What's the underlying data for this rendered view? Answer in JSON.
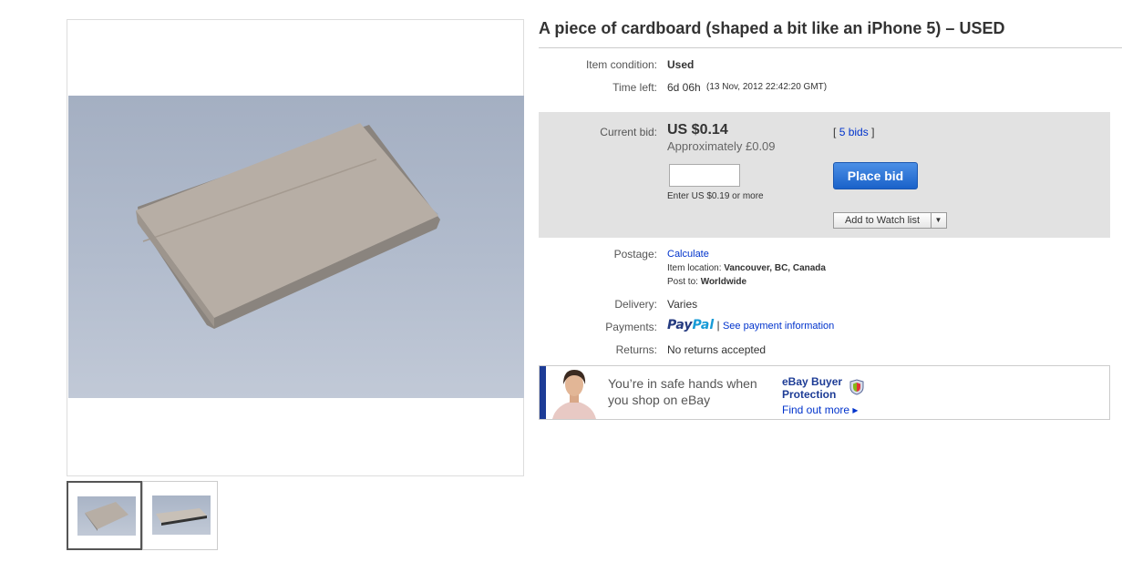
{
  "listing": {
    "title": "A piece of cardboard (shaped a bit like an iPhone 5) – USED",
    "condition_label": "Item condition:",
    "condition_value": "Used",
    "time_left_label": "Time left:",
    "time_left_value": "6d 06h",
    "time_left_end": "(13 Nov, 2012  22:42:20 GMT)"
  },
  "bid": {
    "current_label": "Current bid:",
    "price": "US $0.14",
    "approx": "Approximately £0.09",
    "bids_open": "[",
    "bids_link": "5 bids",
    "bids_close": "]",
    "input_value": "",
    "hint": "Enter US $0.19 or more",
    "place_bid_label": "Place bid",
    "watch_label": "Add to Watch list",
    "watch_arrow": "▼"
  },
  "shipping": {
    "postage_label": "Postage:",
    "postage_link": "Calculate",
    "location_label": "Item location:",
    "location_value": "Vancouver, BC, Canada",
    "post_to_label": "Post to:",
    "post_to_value": "Worldwide",
    "delivery_label": "Delivery:",
    "delivery_value": "Varies",
    "payments_label": "Payments:",
    "paypal_part1": "Pay",
    "paypal_part2": "Pal",
    "payments_sep": "|",
    "payments_link": "See payment information",
    "returns_label": "Returns:",
    "returns_value": "No returns accepted"
  },
  "protection": {
    "line1": "You’re in safe hands when",
    "line2": "you shop on eBay",
    "brand_line1": "eBay Buyer",
    "brand_line2": "Protection",
    "find_out": "Find out more ▸"
  },
  "colors": {
    "link": "#0033cc",
    "place_bid": "#1a62c9",
    "bid_box": "#e2e2e2",
    "protection_bar": "#1d3c96"
  },
  "icons": [
    "image-thumbnail",
    "paypal-logo",
    "shield-icon",
    "chevron-down-icon"
  ]
}
